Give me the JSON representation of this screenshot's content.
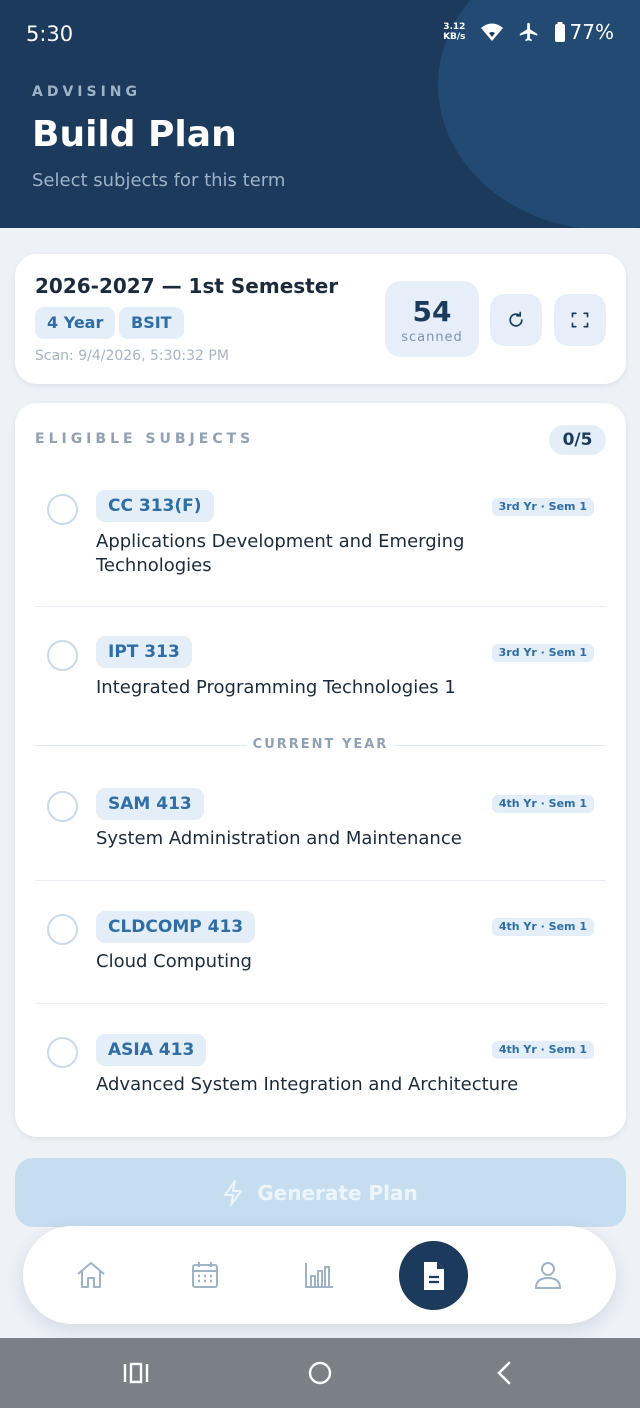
{
  "status_bar": {
    "time": "5:30",
    "net_speed_value": "3.12",
    "net_speed_unit": "KB/s",
    "battery": "77%"
  },
  "header": {
    "eyebrow": "ADVISING",
    "title": "Build Plan",
    "subtitle": "Select subjects for this term"
  },
  "term": {
    "title": "2026-2027 — 1st Semester",
    "year_badge": "4 Year",
    "program_badge": "BSIT",
    "scan_time": "Scan: 9/4/2026, 5:30:32 PM",
    "scanned_count": "54",
    "scanned_label": "scanned"
  },
  "subjects": {
    "section_label": "ELIGIBLE SUBJECTS",
    "selected_count": "0/5",
    "current_year_label": "CURRENT YEAR",
    "items": [
      {
        "code": "CC 313(F)",
        "year_sem": "3rd Yr · Sem 1",
        "name": "Applications Development and Emerging Technologies",
        "selected": false
      },
      {
        "code": "IPT 313",
        "year_sem": "3rd Yr · Sem 1",
        "name": "Integrated Programming Technologies 1",
        "selected": false
      },
      {
        "code": "SAM 413",
        "year_sem": "4th Yr · Sem 1",
        "name": "System Administration and Maintenance",
        "selected": false
      },
      {
        "code": "CLDCOMP 413",
        "year_sem": "4th Yr · Sem 1",
        "name": "Cloud Computing",
        "selected": false
      },
      {
        "code": "ASIA 413",
        "year_sem": "4th Yr · Sem 1",
        "name": "Advanced System Integration and Architecture",
        "selected": false
      }
    ]
  },
  "actions": {
    "generate_label": "Generate Plan"
  },
  "tabs": [
    {
      "icon": "home-icon",
      "active": false
    },
    {
      "icon": "calendar-icon",
      "active": false
    },
    {
      "icon": "chart-icon",
      "active": false
    },
    {
      "icon": "document-icon",
      "active": true
    },
    {
      "icon": "user-icon",
      "active": false
    }
  ],
  "colors": {
    "primary": "#1b3a5c",
    "accent": "#2f6da6",
    "badge_bg": "#e3eef9",
    "disabled_button": "#c6ddef"
  }
}
